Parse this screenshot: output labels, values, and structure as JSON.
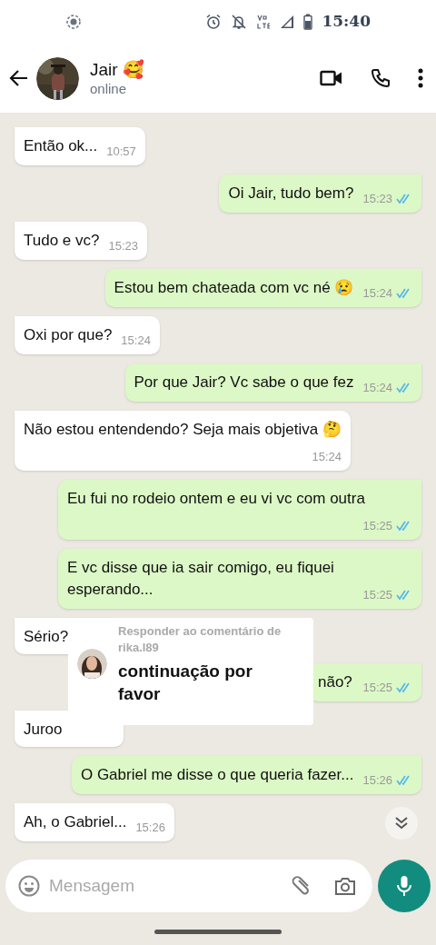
{
  "status_bar": {
    "time": "15:40"
  },
  "header": {
    "name": "Jair 🥰",
    "status": "online"
  },
  "messages": [
    {
      "kind": "incoming",
      "text": "Então ok...",
      "time": "10:57"
    },
    {
      "kind": "outgoing",
      "text": "Oi Jair, tudo bem?",
      "time": "15:23",
      "read": true
    },
    {
      "kind": "incoming",
      "text": "Tudo e vc?",
      "time": "15:23"
    },
    {
      "kind": "outgoing",
      "text": "Estou bem chateada com vc né 😢",
      "time": "15:24",
      "read": true
    },
    {
      "kind": "incoming",
      "text": "Oxi por que?",
      "time": "15:24"
    },
    {
      "kind": "outgoing",
      "text": "Por que Jair? Vc sabe o que fez",
      "time": "15:24",
      "read": true
    },
    {
      "kind": "incoming",
      "text": "Não estou entendendo? Seja mais objetiva 🤔",
      "time": "15:24"
    },
    {
      "kind": "outgoing",
      "text": "Eu fui no rodeio ontem e eu vi vc com outra",
      "time": "15:25",
      "read": true
    },
    {
      "kind": "outgoing",
      "text": "E vc disse que ia sair comigo, eu fiquei esperando...",
      "time": "15:25",
      "read": true
    },
    {
      "kind": "incoming",
      "text": "Sério?"
    },
    {
      "kind": "outgoing",
      "text": "não?",
      "time": "15:25",
      "read": true
    },
    {
      "kind": "incoming",
      "text": "Juroo"
    },
    {
      "kind": "outgoing",
      "text": "O Gabriel me disse o que queria fazer...",
      "time": "15:26",
      "read": true
    },
    {
      "kind": "incoming",
      "text": "Ah, o Gabriel...",
      "time": "15:26"
    }
  ],
  "comment_overlay": {
    "title": "Responder ao comentário de rika.l89",
    "text": "continuação por favor"
  },
  "composer": {
    "placeholder": "Mensagem"
  }
}
